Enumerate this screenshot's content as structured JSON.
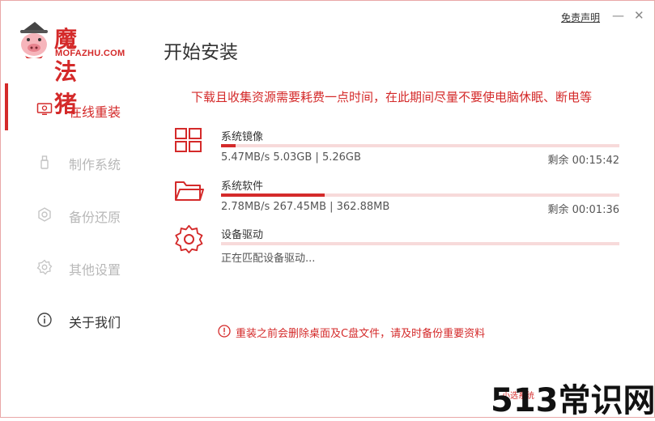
{
  "brand": {
    "name_cn": "魔法猪",
    "name_en": "MOFAZHU.COM",
    "accent": "#d42a2a"
  },
  "window": {
    "title": "开始安装",
    "disclaimer": "免责声明",
    "minimize": "—",
    "close": "✕"
  },
  "sidebar": {
    "items": [
      {
        "label": "在线重装",
        "icon": "monitor-icon",
        "state": "active"
      },
      {
        "label": "制作系统",
        "icon": "usb-drive-icon",
        "state": "disabled"
      },
      {
        "label": "备份还原",
        "icon": "backup-icon",
        "state": "disabled"
      },
      {
        "label": "其他设置",
        "icon": "gear-icon",
        "state": "disabled"
      },
      {
        "label": "关于我们",
        "icon": "info-icon",
        "state": "normal"
      }
    ]
  },
  "main": {
    "notice": "下载且收集资源需要耗费一点时间，在此期间尽量不要使电脑休眠、断电等",
    "tasks": [
      {
        "name": "系统镜像",
        "icon": "windows-icon",
        "stats": "5.47MB/s 5.03GB | 5.26GB",
        "remaining": "剩余 00:15:42",
        "progress": 0.037
      },
      {
        "name": "系统软件",
        "icon": "folder-icon",
        "stats": "2.78MB/s 267.45MB | 362.88MB",
        "remaining": "剩余 00:01:36",
        "progress": 0.26
      },
      {
        "name": "设备驱动",
        "icon": "gear-icon",
        "stats": "正在匹配设备驱动...",
        "remaining": "",
        "progress": 0
      }
    ],
    "bottom_warning": "重装之前会删除桌面及C盘文件，请及时备份重要资料"
  },
  "watermark": {
    "text": "513常识网",
    "small": "小选系统"
  }
}
